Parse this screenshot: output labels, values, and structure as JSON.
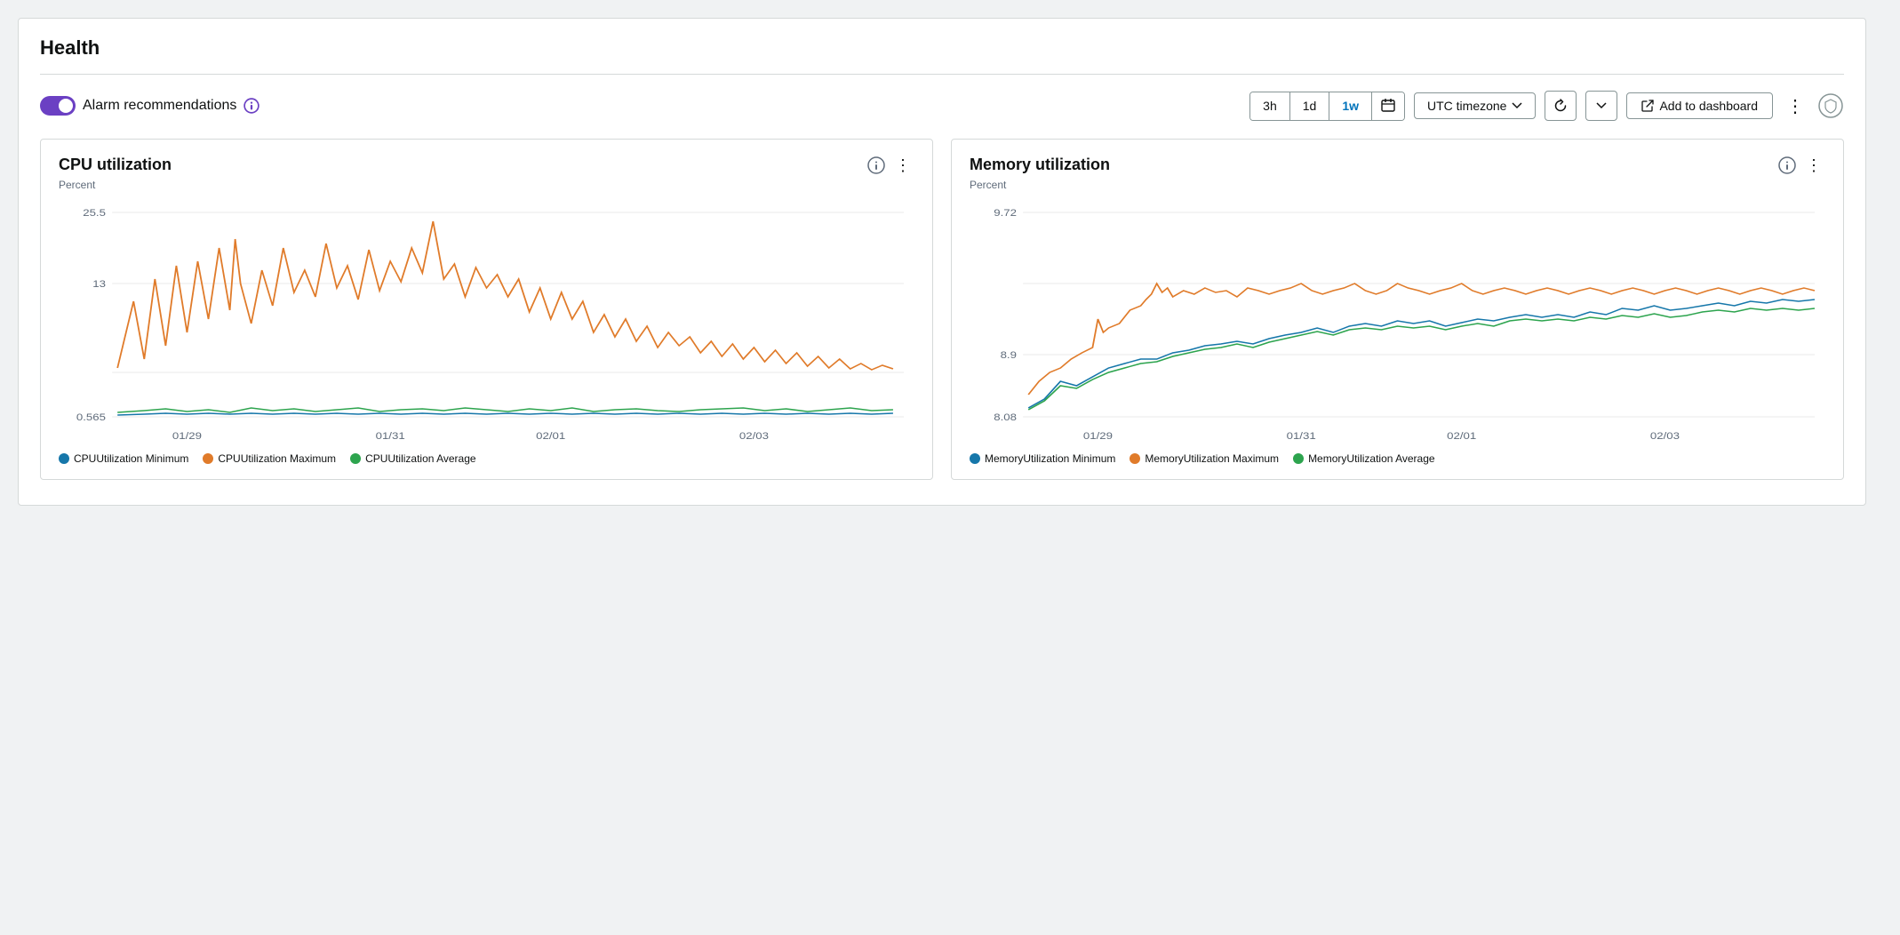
{
  "page": {
    "title": "Health"
  },
  "toolbar": {
    "alarm_label": "Alarm recommendations",
    "time_buttons": [
      "3h",
      "1d",
      "1w"
    ],
    "active_time": "1w",
    "timezone_label": "UTC timezone",
    "add_dashboard_label": "Add to dashboard",
    "more_options_label": "⋮"
  },
  "charts": [
    {
      "id": "cpu",
      "title": "CPU utilization",
      "y_label": "Percent",
      "y_max": "25.5",
      "y_mid": "13",
      "y_min": "0.565",
      "x_labels": [
        "01/29",
        "01/31",
        "02/01",
        "02/03"
      ],
      "legend": [
        {
          "label": "CPUUtilization Minimum",
          "color": "#1677aa"
        },
        {
          "label": "CPUUtilization Maximum",
          "color": "#e07b2a"
        },
        {
          "label": "CPUUtilization Average",
          "color": "#2da44e"
        }
      ]
    },
    {
      "id": "memory",
      "title": "Memory utilization",
      "y_label": "Percent",
      "y_max": "9.72",
      "y_mid": "8.9",
      "y_min": "8.08",
      "x_labels": [
        "01/29",
        "01/31",
        "02/01",
        "02/03"
      ],
      "legend": [
        {
          "label": "MemoryUtilization Minimum",
          "color": "#1677aa"
        },
        {
          "label": "MemoryUtilization Maximum",
          "color": "#e07b2a"
        },
        {
          "label": "MemoryUtilization Average",
          "color": "#2da44e"
        }
      ]
    }
  ]
}
